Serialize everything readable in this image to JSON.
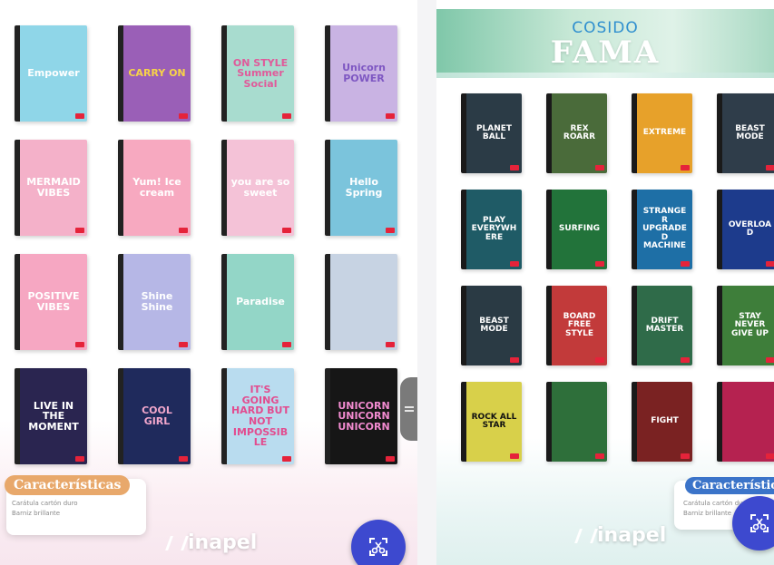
{
  "left_panel": {
    "notebooks": [
      {
        "title": "Empower",
        "bg": "#8fd6e8",
        "color": "#ffffff"
      },
      {
        "title": "CARRY ON",
        "bg": "#9a5fb7",
        "color": "#f7d348"
      },
      {
        "title": "ON STYLE Summer Social",
        "bg": "#a8dccf",
        "color": "#e05a9a"
      },
      {
        "title": "Unicorn POWER",
        "bg": "#c9b3e3",
        "color": "#7e57c2"
      },
      {
        "title": "MERMAID VIBES",
        "bg": "#f4b1c9",
        "color": "#ffffff"
      },
      {
        "title": "Yum! Ice cream",
        "bg": "#f7a9c0",
        "color": "#ffffff"
      },
      {
        "title": "you are so sweet",
        "bg": "#f4c2d7",
        "color": "#ffffff"
      },
      {
        "title": "Hello Spring",
        "bg": "#7bc4dc",
        "color": "#ffffff"
      },
      {
        "title": "POSITIVE VIBES",
        "bg": "#f6a7c2",
        "color": "#ffffff"
      },
      {
        "title": "Shine Shine",
        "bg": "#b6b7e6",
        "color": "#ffffff"
      },
      {
        "title": "Paradise",
        "bg": "#93d6c7",
        "color": "#ffffff"
      },
      {
        "title": "",
        "bg": "#c7d3e3",
        "color": "#5b5b5b"
      },
      {
        "title": "LIVE IN THE MOMENT",
        "bg": "#2a2550",
        "color": "#ffffff"
      },
      {
        "title": "COOL GIRL",
        "bg": "#1f2a5c",
        "color": "#f2a7cc"
      },
      {
        "title": "IT'S GOING HARD BUT NOT IMPOSSIBLE",
        "bg": "#b9dcef",
        "color": "#e24c8f"
      },
      {
        "title": "UNICORN UNICORN UNICORN",
        "bg": "#161616",
        "color": "#f28bd0"
      }
    ],
    "characteristics": {
      "title": "Características",
      "items": [
        "Carátula cartón duro",
        "Barniz brillante"
      ]
    },
    "brand": "inapel"
  },
  "right_panel": {
    "banner": {
      "subtitle": "COSIDO",
      "title": "FAMA"
    },
    "notebooks": [
      {
        "title": "PLANET BALL",
        "bg": "#2b3b46",
        "color": "#ffffff"
      },
      {
        "title": "REX ROARR",
        "bg": "#4a6b3a",
        "color": "#ffffff"
      },
      {
        "title": "EXTREME",
        "bg": "#e7a12a",
        "color": "#ffffff"
      },
      {
        "title": "BEAST MODE",
        "bg": "#2f3d4a",
        "color": "#ffffff"
      },
      {
        "title": "PLAY EVERYWHERE",
        "bg": "#1f5b66",
        "color": "#ffffff"
      },
      {
        "title": "SURFING",
        "bg": "#22733a",
        "color": "#ffffff"
      },
      {
        "title": "STRANGER UPGRADED MACHINE",
        "bg": "#1e6fa6",
        "color": "#ffffff"
      },
      {
        "title": "OVERLOAD",
        "bg": "#1d3b8c",
        "color": "#ffffff"
      },
      {
        "title": "BEAST MODE",
        "bg": "#2a3a44",
        "color": "#ffffff"
      },
      {
        "title": "BOARD FREE STYLE",
        "bg": "#c23a3a",
        "color": "#ffffff"
      },
      {
        "title": "DRIFT MASTER",
        "bg": "#2f6b49",
        "color": "#ffffff"
      },
      {
        "title": "STAY NEVER GIVE UP",
        "bg": "#3e7e3a",
        "color": "#ffffff"
      },
      {
        "title": "ROCK ALL STAR",
        "bg": "#d8d04a",
        "color": "#111111"
      },
      {
        "title": "",
        "bg": "#2e6f3a",
        "color": "#ffffff"
      },
      {
        "title": "FIGHT",
        "bg": "#7a2222",
        "color": "#ffffff"
      },
      {
        "title": "",
        "bg": "#b52250",
        "color": "#ffffff"
      }
    ],
    "characteristics": {
      "title": "Característica",
      "items": [
        "Carátula cartón dur",
        "Barniz brillante"
      ]
    },
    "brand": "inapel"
  },
  "icons": {
    "fab": "scissors-crop-icon",
    "handle": "drag-handle-icon"
  },
  "colors": {
    "fab": "#3d49cf",
    "left_characteristics": "#e8a86b",
    "right_characteristics": "#3b74c9"
  }
}
